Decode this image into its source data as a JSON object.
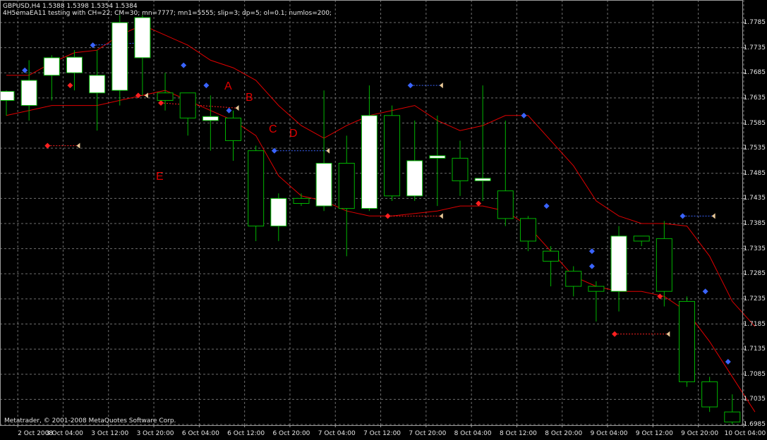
{
  "header": {
    "symbol_line": "GBPUSD,H4  1.5388 1.5398 1.5354 1.5384",
    "ea_line": "4H5emaEA11 testing with CH=22; CM=30; mn=7777; mn1=5555; slip=3; dp=5; ol=0.1; numlos=200;"
  },
  "copyright": "Metatrader, © 2001-2008 MetaQuotes Software Corp.",
  "colors": {
    "background": "#000000",
    "grid": "#6e6e6e",
    "bull_body": "#ffffff",
    "candle_outline": "#00b400",
    "channel": "#e00000",
    "annotation": "#e00000",
    "buy_arrow": "#3a64ff",
    "sell_arrow": "#ff2020",
    "close_marker": "#e8c898"
  },
  "annotations": [
    "A",
    "B",
    "C",
    "D",
    "E"
  ],
  "chart_data": {
    "type": "candlestick",
    "symbol": "GBPUSD",
    "timeframe": "H4",
    "ylim": [
      1.6985,
      1.7785
    ],
    "y_ticks": [
      "1.7785",
      "1.7735",
      "1.7685",
      "1.7635",
      "1.7585",
      "1.7535",
      "1.7485",
      "1.7435",
      "1.7385",
      "1.7335",
      "1.7285",
      "1.7235",
      "1.7185",
      "1.7135",
      "1.7085",
      "1.7035",
      "1.6985"
    ],
    "x_ticks": [
      "2 Oct 2008",
      "3 Oct 04:00",
      "3 Oct 12:00",
      "3 Oct 20:00",
      "6 Oct 04:00",
      "6 Oct 12:00",
      "6 Oct 20:00",
      "7 Oct 04:00",
      "7 Oct 12:00",
      "7 Oct 20:00",
      "8 Oct 04:00",
      "8 Oct 12:00",
      "8 Oct 20:00",
      "9 Oct 04:00",
      "9 Oct 12:00",
      "9 Oct 20:00",
      "10 Oct 04:00"
    ],
    "candles": [
      {
        "o": 1.763,
        "h": 1.765,
        "l": 1.76,
        "c": 1.7648
      },
      {
        "o": 1.762,
        "h": 1.771,
        "l": 1.759,
        "c": 1.767
      },
      {
        "o": 1.768,
        "h": 1.772,
        "l": 1.763,
        "c": 1.7715
      },
      {
        "o": 1.7685,
        "h": 1.773,
        "l": 1.765,
        "c": 1.7716
      },
      {
        "o": 1.7645,
        "h": 1.773,
        "l": 1.757,
        "c": 1.768
      },
      {
        "o": 1.765,
        "h": 1.78,
        "l": 1.762,
        "c": 1.7785
      },
      {
        "o": 1.7715,
        "h": 1.78,
        "l": 1.764,
        "c": 1.7795
      },
      {
        "o": 1.7645,
        "h": 1.7685,
        "l": 1.761,
        "c": 1.763
      },
      {
        "o": 1.7645,
        "h": 1.7645,
        "l": 1.756,
        "c": 1.7595
      },
      {
        "o": 1.759,
        "h": 1.764,
        "l": 1.753,
        "c": 1.7598
      },
      {
        "o": 1.7595,
        "h": 1.761,
        "l": 1.751,
        "c": 1.755
      },
      {
        "o": 1.753,
        "h": 1.754,
        "l": 1.735,
        "c": 1.738
      },
      {
        "o": 1.738,
        "h": 1.7445,
        "l": 1.735,
        "c": 1.7435
      },
      {
        "o": 1.7435,
        "h": 1.7445,
        "l": 1.742,
        "c": 1.7425
      },
      {
        "o": 1.742,
        "h": 1.765,
        "l": 1.741,
        "c": 1.7505
      },
      {
        "o": 1.7505,
        "h": 1.756,
        "l": 1.732,
        "c": 1.7415
      },
      {
        "o": 1.7415,
        "h": 1.766,
        "l": 1.741,
        "c": 1.76
      },
      {
        "o": 1.76,
        "h": 1.762,
        "l": 1.743,
        "c": 1.744
      },
      {
        "o": 1.744,
        "h": 1.759,
        "l": 1.743,
        "c": 1.751
      },
      {
        "o": 1.7515,
        "h": 1.76,
        "l": 1.742,
        "c": 1.752
      },
      {
        "o": 1.7515,
        "h": 1.755,
        "l": 1.744,
        "c": 1.747
      },
      {
        "o": 1.747,
        "h": 1.766,
        "l": 1.743,
        "c": 1.7475
      },
      {
        "o": 1.745,
        "h": 1.759,
        "l": 1.738,
        "c": 1.7395
      },
      {
        "o": 1.7395,
        "h": 1.74,
        "l": 1.733,
        "c": 1.735
      },
      {
        "o": 1.733,
        "h": 1.734,
        "l": 1.726,
        "c": 1.731
      },
      {
        "o": 1.729,
        "h": 1.73,
        "l": 1.724,
        "c": 1.726
      },
      {
        "o": 1.726,
        "h": 1.727,
        "l": 1.719,
        "c": 1.725
      },
      {
        "o": 1.725,
        "h": 1.738,
        "l": 1.721,
        "c": 1.736
      },
      {
        "o": 1.736,
        "h": 1.736,
        "l": 1.734,
        "c": 1.735
      },
      {
        "o": 1.7355,
        "h": 1.739,
        "l": 1.722,
        "c": 1.725
      },
      {
        "o": 1.723,
        "h": 1.724,
        "l": 1.706,
        "c": 1.707
      },
      {
        "o": 1.707,
        "h": 1.708,
        "l": 1.701,
        "c": 1.702
      },
      {
        "o": 1.701,
        "h": 1.7045,
        "l": 1.6985,
        "c": 1.699
      }
    ],
    "channel_upper": [
      1.768,
      1.768,
      1.7705,
      1.7725,
      1.773,
      1.776,
      1.778,
      1.776,
      1.774,
      1.771,
      1.7695,
      1.767,
      1.762,
      1.758,
      1.7555,
      1.758,
      1.76,
      1.761,
      1.762,
      1.759,
      1.757,
      1.758,
      1.76,
      1.76,
      1.755,
      1.75,
      1.743,
      1.74,
      1.7385,
      1.7385,
      1.738,
      1.732,
      1.723,
      1.718
    ],
    "channel_lower": [
      1.76,
      1.761,
      1.762,
      1.762,
      1.762,
      1.763,
      1.764,
      1.765,
      1.763,
      1.761,
      1.759,
      1.756,
      1.748,
      1.744,
      1.743,
      1.741,
      1.74,
      1.74,
      1.7405,
      1.741,
      1.742,
      1.742,
      1.741,
      1.738,
      1.733,
      1.728,
      1.726,
      1.725,
      1.725,
      1.724,
      1.721,
      1.715,
      1.708,
      1.701
    ]
  }
}
